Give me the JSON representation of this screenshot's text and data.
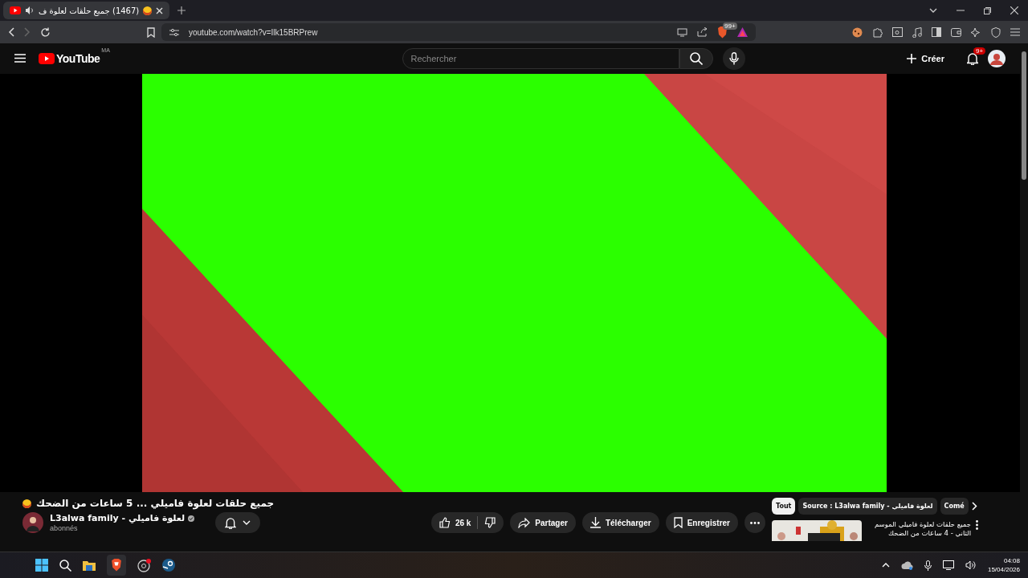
{
  "browser": {
    "tab": {
      "title": "(1467) جميع حلقات لعلوة ف",
      "selected": true
    },
    "url": "youtube.com/watch?v=Ilk15BRPrew",
    "extension_badge": "99+"
  },
  "youtube": {
    "logo": "YouTube",
    "logo_badge": "MA",
    "search": {
      "placeholder": "Rechercher"
    },
    "create": "Créer",
    "notifications": "9+"
  },
  "video": {
    "title": "جميع حلقات لعلوة فاميلي ... 5 ساعات من الضحك",
    "channel": "L3alwa family - لعلوة فاميلي",
    "subscribers": "abonnés",
    "likes": "26 k",
    "actions": [
      "Partager",
      "Télécharger",
      "Enregistrer"
    ]
  },
  "chips": [
    {
      "label": "Tout",
      "selected": true
    },
    {
      "label": "Source : L3alwa family - لعلوة فاميلي",
      "selected": false
    },
    {
      "label": "Comé",
      "selected": false
    }
  ],
  "recommended": [
    {
      "title": "جميع حلقات لعلوة فاميلي الموسم الثاني - 4 ساعات من الضحك"
    }
  ],
  "taskbar": {
    "time": "04:08",
    "date": "15/04/2026"
  }
}
